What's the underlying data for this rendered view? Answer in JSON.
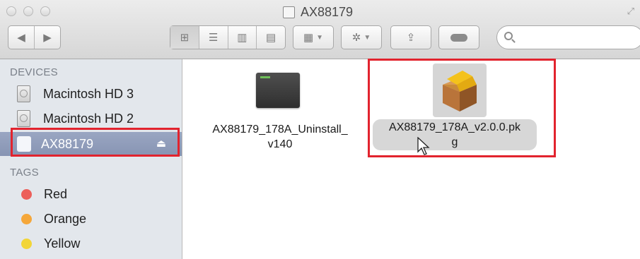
{
  "window": {
    "title": "AX88179"
  },
  "toolbar": {
    "back_icon": "triangle-left-icon",
    "forward_icon": "triangle-right-icon",
    "views": [
      "icon-view-icon",
      "list-view-icon",
      "column-view-icon",
      "coverflow-view-icon"
    ],
    "active_view": "icon-view-icon",
    "search": {
      "value": "",
      "placeholder": ""
    }
  },
  "sidebar": {
    "devices_heading": "DEVICES",
    "devices": [
      {
        "label": "Macintosh HD 3",
        "icon": "hard-disk-icon"
      },
      {
        "label": "Macintosh HD 2",
        "icon": "hard-disk-icon"
      },
      {
        "label": "AX88179",
        "icon": "external-drive-icon",
        "selected": true,
        "eject_glyph": "⏏"
      }
    ],
    "tags_heading": "TAGS",
    "tags": [
      {
        "label": "Red",
        "color": "#ec5f5a"
      },
      {
        "label": "Orange",
        "color": "#f5a73a"
      },
      {
        "label": "Yellow",
        "color": "#f2d537"
      }
    ]
  },
  "files": [
    {
      "name_line1": "AX88179_178A_Uninstall_",
      "name_line2": "v140",
      "icon": "terminal-script-icon",
      "selected": false
    },
    {
      "name_line1": "AX88179_178A_v2.0.0.pk",
      "name_line2": "g",
      "icon": "package-installer-icon",
      "selected": true
    }
  ],
  "highlight_color": "#e2232e"
}
